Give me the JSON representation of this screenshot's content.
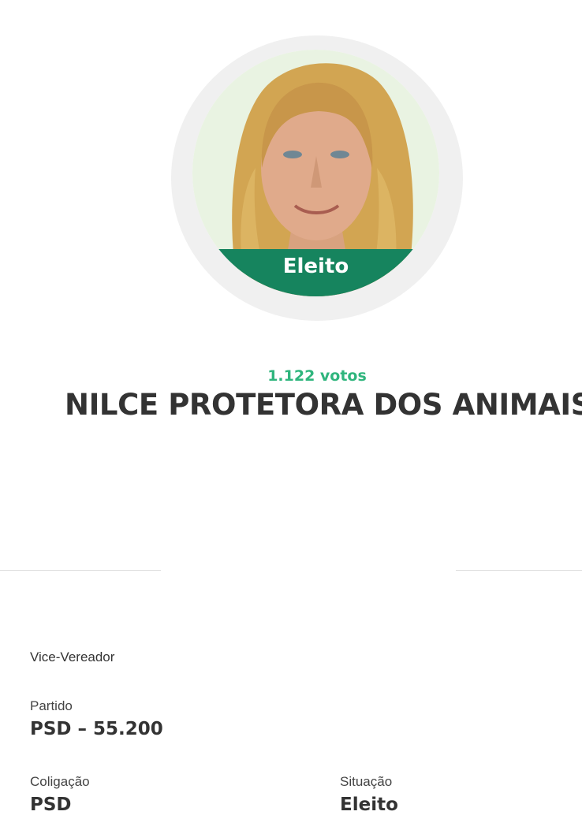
{
  "candidate": {
    "status_badge": "Eleito",
    "votes": "1.122 votos",
    "name": "NILCE PROTETORA DOS ANIMAIS",
    "role": "Vice-Vereador"
  },
  "fields": {
    "partido_label": "Partido",
    "partido_value": "PSD – 55.200",
    "coligacao_label": "Coligação",
    "coligacao_value": "PSD",
    "situacao_label": "Situação",
    "situacao_value": "Eleito"
  },
  "colors": {
    "status_green": "#16845e",
    "votes_green": "#2fb57d",
    "text_dark": "#333333"
  }
}
